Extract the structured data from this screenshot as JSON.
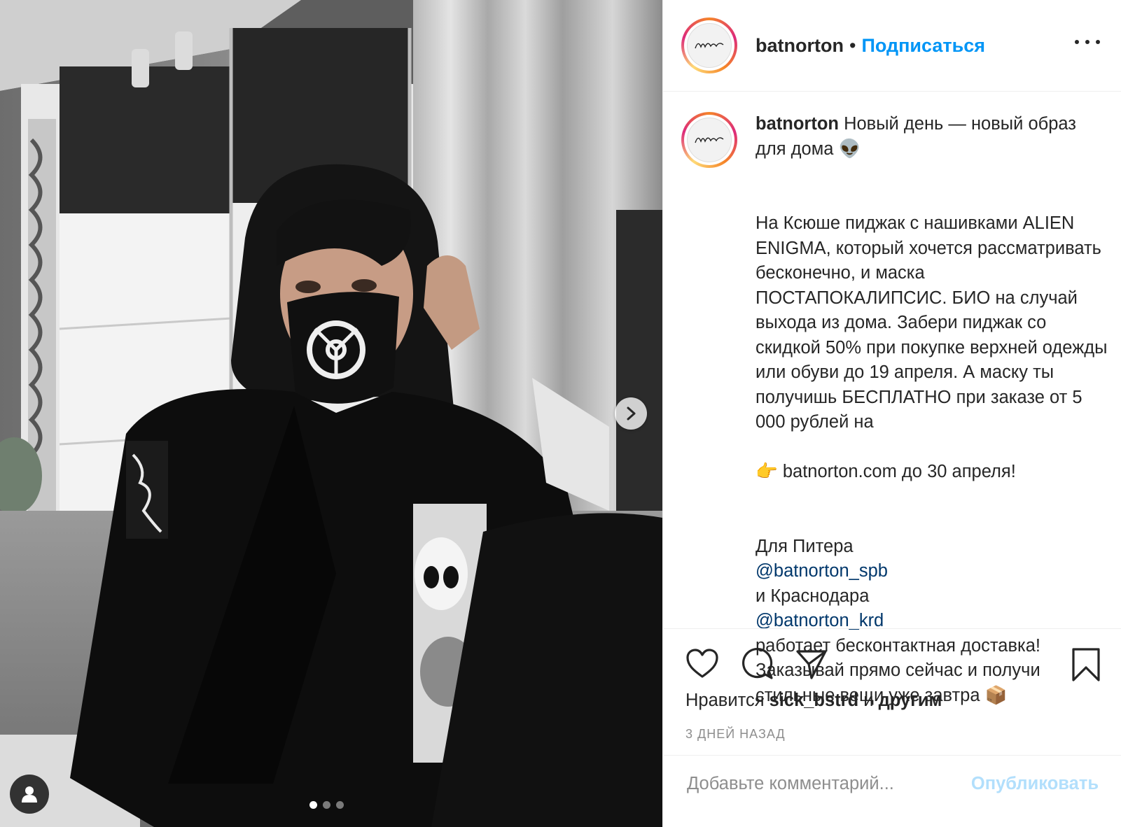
{
  "header": {
    "username": "batnorton",
    "separator": "•",
    "follow_label": "Подписаться"
  },
  "caption": {
    "username": "batnorton",
    "line1": "Новый день — новый образ для дома 👽",
    "paragraph2": "На Ксюше пиджак с нашивками ALIEN ENIGMA, который хочется рассматривать бесконечно, и маска ПОСТАПОКАЛИПСИС. БИО на случай выхода из дома. Забери пиджак со скидкой 50% при покупке верхней одежды или обуви до 19 апреля. А маску ты получишь БЕСПЛАТНО при заказе от 5 000 рублей на",
    "paragraph2_end": "👉  batnorton.com до 30 апреля!",
    "p3_start": "Для Питера",
    "mention1": "@batnorton_spb",
    "p3_mid": "и Краснодара",
    "mention2": "@batnorton_krd",
    "p3_end": "работает бесконтактная доставка! Заказывай прямо сейчас и получи стильные вещи уже завтра 📦"
  },
  "likes": {
    "prefix": "Нравится",
    "user": "sick_bstrd",
    "middle": "и",
    "others": "другим"
  },
  "timestamp": "3 ДНЕЙ НАЗАД",
  "comment": {
    "placeholder": "Добавьте комментарий...",
    "post_label": "Опубликовать"
  },
  "carousel": {
    "total": 3,
    "active_index": 0
  },
  "colors": {
    "accent": "#0095f6",
    "mention": "#00376b",
    "post_disabled": "#b2dffc",
    "muted": "#8e8e8e",
    "text": "#262626"
  },
  "icons": [
    "heart-icon",
    "comment-icon",
    "share-icon",
    "bookmark-icon",
    "more-icon",
    "chevron-right-icon",
    "user-tag-icon"
  ]
}
